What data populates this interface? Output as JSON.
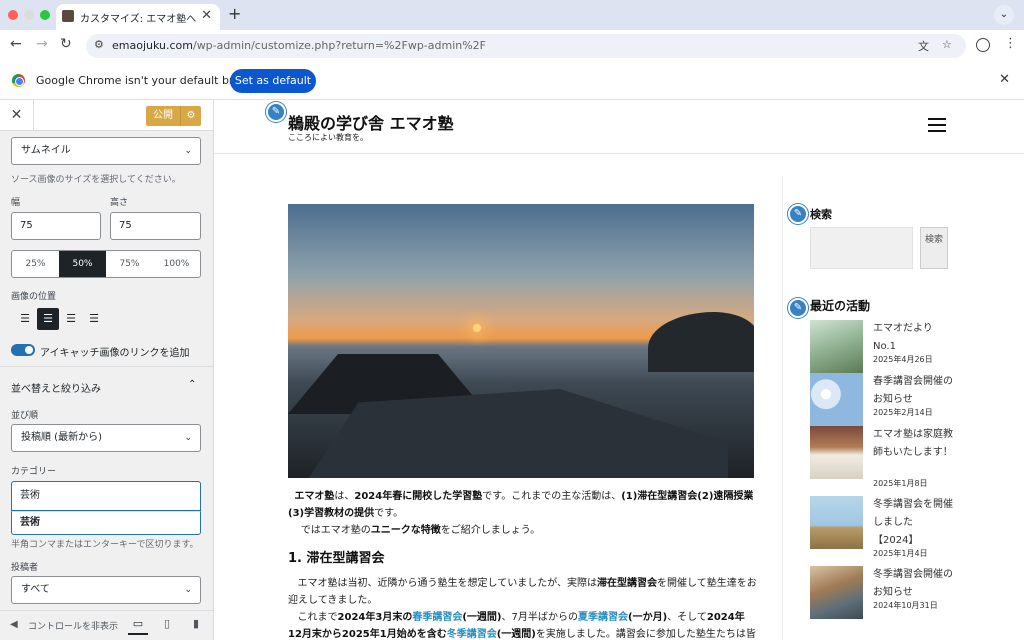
{
  "browser": {
    "tab_title": "カスタマイズ: エマオ塾へようこそ",
    "tab_close": "✕",
    "new_tab": "+",
    "url_host": "emaojuku.com",
    "url_path": "/wp-admin/customize.php?return=%2Fwp-admin%2F",
    "infobar_text": "Google Chrome isn't your default browser",
    "set_default_label": "Set as default"
  },
  "customizer": {
    "publish_label": "公開",
    "image_size_value": "サムネイル",
    "image_size_help": "ソース画像のサイズを選択してください。",
    "width_label": "幅",
    "width_value": "75",
    "height_label": "高さ",
    "height_value": "75",
    "percent_options": [
      "25%",
      "50%",
      "75%",
      "100%"
    ],
    "percent_selected": "50%",
    "image_position_label": "画像の位置",
    "featured_link_label": "アイキャッチ画像のリンクを追加",
    "sort_filter_title": "並べ替えと絞り込み",
    "order_label": "並び順",
    "order_value": "投稿順 (最新から)",
    "category_label": "カテゴリー",
    "category_input": "芸術",
    "category_suggestion": "芸術",
    "category_help": "半角コンマまたはエンターキーで区切ります。",
    "author_label": "投稿者",
    "author_value": "すべて",
    "hide_controls_label": "コントロールを非表示"
  },
  "site": {
    "title": "鵜殿の学び舎 エマオ塾",
    "tagline": "こころによい教育を。",
    "intro_1a": "エマオ塾",
    "intro_1b": "は、",
    "intro_1c": "2024年春に開校した学習塾",
    "intro_1d": "です。これまでの主な活動は、",
    "intro_1e": "(1)滞在型講習会(2)遠隔授業(3)学習教材の提供",
    "intro_1f": "です。",
    "intro_2a": "では",
    "intro_2b": "エマオ塾の",
    "intro_2c": "ユニークな特徴",
    "intro_2d": "をご紹介しましょう。",
    "heading_1": "1. 滞在型講習会",
    "p2_a": "エマオ塾は当初、近隣から通う塾生を想定していましたが、実際は",
    "p2_b": "滞在型講習会",
    "p2_c": "を開催して塾生達をお迎えしてきました。",
    "p3_a": "これまで",
    "p3_b": "2024年3月末の",
    "p3_c": "春季講習会",
    "p3_d": "(一週間)",
    "p3_e": "、7月半ばからの",
    "p3_f": "夏季講習会",
    "p3_g": "(一か月)",
    "p3_h": "、そして",
    "p3_i": "2024年12月末から2025年1月始めを含む",
    "p3_j": "冬季講習会",
    "p3_k": "(一週間)",
    "p3_l": "を実施しました。講習会に参加した塾生たちは皆遠方か"
  },
  "widgets": {
    "search_title": "検索",
    "search_button": "検索",
    "recent_title": "最近の活動",
    "posts": [
      {
        "title": "エマオだより No.1",
        "date": "2025年4月26日"
      },
      {
        "title": "春季講習会開催のお知らせ",
        "date": "2025年2月14日"
      },
      {
        "title": "エマオ塾は家庭教師もいたします！",
        "date": "2025年1月8日"
      },
      {
        "title": "冬季講習会を開催しました【2024】",
        "date": "2025年1月4日"
      },
      {
        "title": "冬季講習会開催のお知らせ",
        "date": "2024年10月31日"
      }
    ]
  }
}
